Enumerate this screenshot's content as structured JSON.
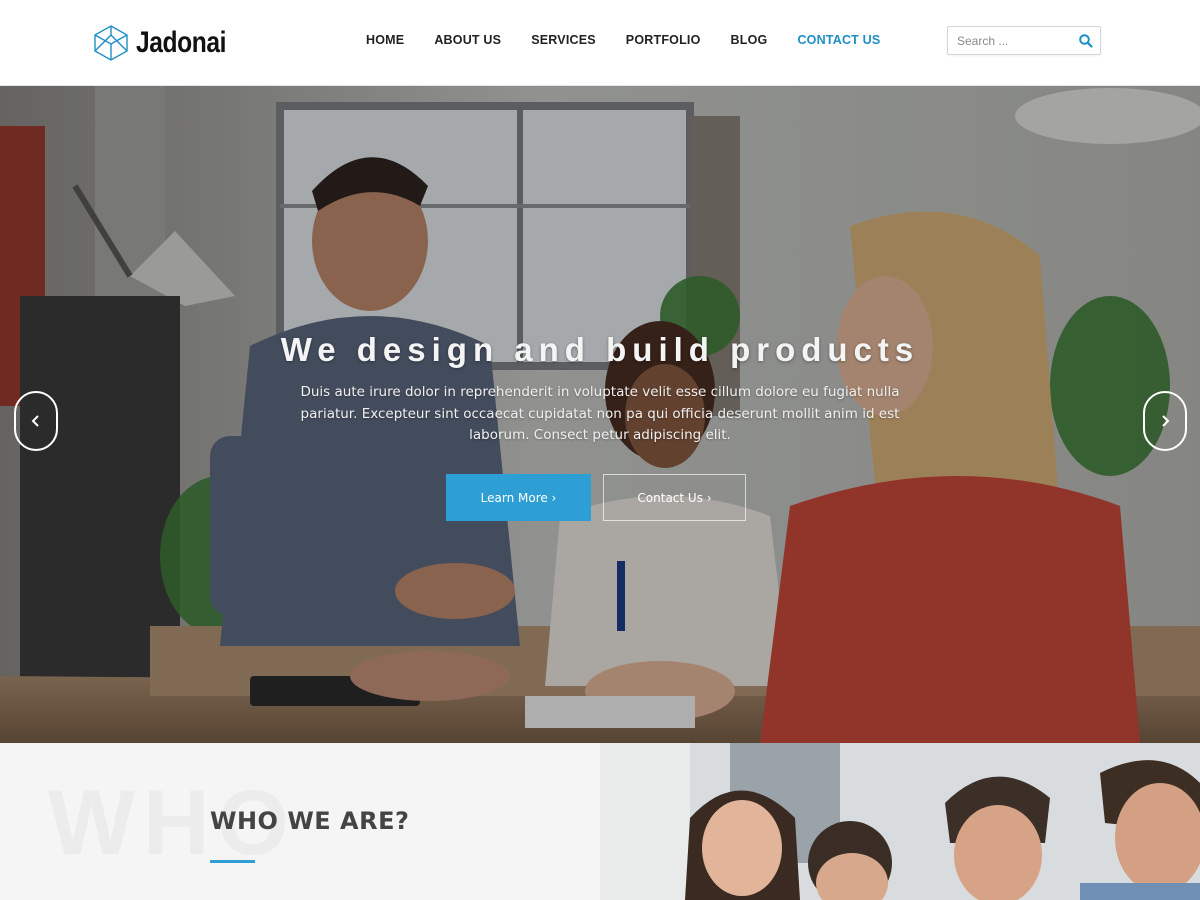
{
  "brand": {
    "name": "Jadonai",
    "accent": "#2e9fd4"
  },
  "nav": {
    "items": [
      {
        "label": "HOME"
      },
      {
        "label": "ABOUT US"
      },
      {
        "label": "SERVICES"
      },
      {
        "label": "PORTFOLIO"
      },
      {
        "label": "BLOG"
      },
      {
        "label": "CONTACT US"
      }
    ],
    "active_index": 5
  },
  "search": {
    "placeholder": "Search ...",
    "icon": "search-icon"
  },
  "hero": {
    "title": "We design and build products",
    "description": "Duis aute irure dolor in reprehenderit in voluptate velit esse cillum dolore eu fugiat nulla pariatur. Excepteur sint occaecat cupidatat non pa qui officia deserunt mollit anim id est laborum. Consect petur adipiscing elit.",
    "primary_button": "Learn More ›",
    "secondary_button": "Contact Us ›",
    "prev_icon": "chevron-left-icon",
    "next_icon": "chevron-right-icon"
  },
  "about": {
    "background_word": "WHO",
    "title": "WHO WE ARE?"
  }
}
